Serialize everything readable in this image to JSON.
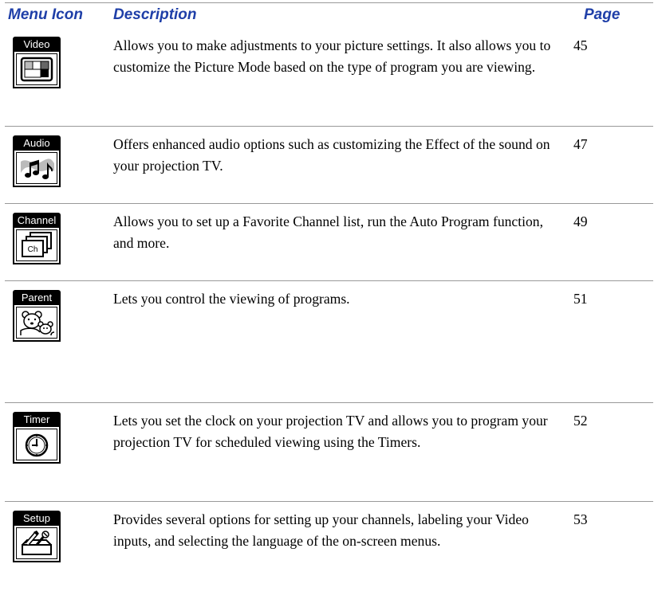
{
  "header": {
    "menu_icon": "Menu Icon",
    "description": "Description",
    "page": "Page"
  },
  "rows": [
    {
      "icon_label": "Video",
      "icon_name": "video-icon",
      "description": "Allows you to make adjustments to your picture settings. It also allows you to customize the Picture Mode based on the type of program you are viewing.",
      "page": "45"
    },
    {
      "icon_label": "Audio",
      "icon_name": "audio-icon",
      "description": "Offers enhanced audio options such as customizing the Effect of the sound on your projection TV.",
      "page": "47"
    },
    {
      "icon_label": "Channel",
      "icon_name": "channel-icon",
      "description": "Allows you to set up a Favorite Channel list, run the Auto Program function, and more.",
      "page": "49"
    },
    {
      "icon_label": "Parent",
      "icon_name": "parent-icon",
      "description": "Lets you control the viewing of programs.",
      "page": "51"
    },
    {
      "icon_label": "Timer",
      "icon_name": "timer-icon",
      "description": "Lets you set the clock on your projection TV and allows you to program your projection TV for scheduled viewing using the Timers.",
      "page": "52"
    },
    {
      "icon_label": "Setup",
      "icon_name": "setup-icon",
      "description": "Provides several options for  setting up your channels, labeling your Video inputs, and selecting the language of the on-screen menus.",
      "page": "53"
    }
  ],
  "channel_icon_text": "Ch"
}
